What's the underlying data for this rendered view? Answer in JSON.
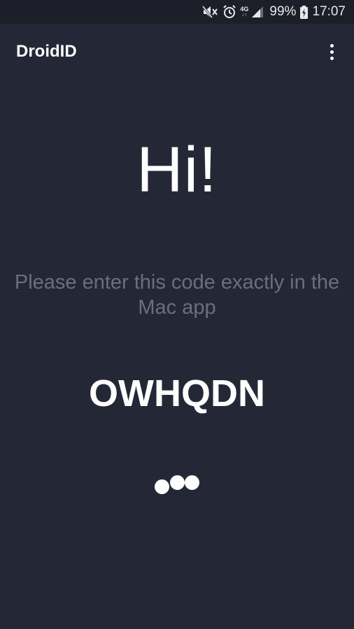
{
  "status_bar": {
    "network_type": "4G",
    "network_arrows": "↓↑",
    "battery_percent": "99%",
    "time": "17:07",
    "icons": [
      "mute-icon",
      "alarm-icon",
      "signal-icon",
      "battery-charging-icon"
    ]
  },
  "app_bar": {
    "title": "DroidID",
    "menu_icon": "overflow-menu-icon"
  },
  "main": {
    "greeting": "Hi!",
    "instruction": "Please enter this code exactly in the Mac app",
    "code": "OWHQDN"
  },
  "colors": {
    "background": "#242836",
    "status_bar": "#1c1f2a",
    "text_primary": "#ffffff",
    "text_secondary": "#6b6f7c"
  }
}
